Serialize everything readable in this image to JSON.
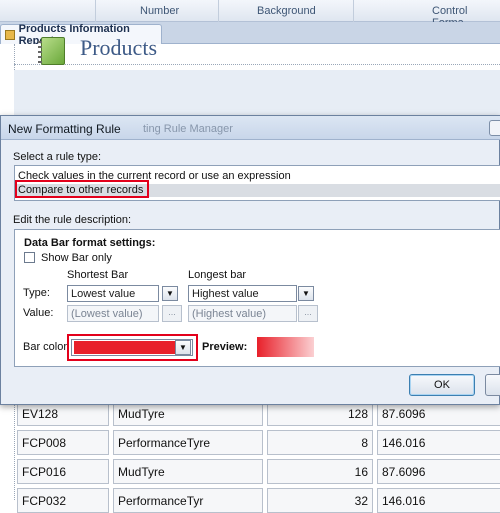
{
  "ribbon": {
    "groups": [
      "Number",
      "Background",
      "Control Forma"
    ]
  },
  "document_tab": {
    "label": "Products Information Report"
  },
  "report": {
    "title": "Products",
    "rows": [
      {
        "code": "EV128",
        "name": "MudTyre",
        "qty": "128",
        "price": "87.6096"
      },
      {
        "code": "FCP008",
        "name": "PerformanceTyre",
        "qty": "8",
        "price": "146.016"
      },
      {
        "code": "FCP016",
        "name": "MudTyre",
        "qty": "16",
        "price": "87.6096"
      },
      {
        "code": "FCP032",
        "name": "PerformanceTyr",
        "qty": "32",
        "price": "146.016"
      }
    ]
  },
  "dialog": {
    "title": "New Formatting Rule",
    "ghost_title": "ting Rule Manager",
    "select_rule_label": "Select a rule type:",
    "rule_types": [
      "Check values in the current record or use an expression",
      "Compare to other records"
    ],
    "selected_rule_index": 1,
    "edit_description_label": "Edit the rule description:",
    "databar_heading": "Data Bar format settings:",
    "show_bar_only_label": "Show Bar only",
    "show_bar_only_checked": false,
    "shortest_bar_label": "Shortest Bar",
    "longest_bar_label": "Longest bar",
    "type_label": "Type:",
    "value_label": "Value:",
    "shortest_type": "Lowest value",
    "longest_type": "Highest value",
    "shortest_value_placeholder": "(Lowest value)",
    "longest_value_placeholder": "(Highest value)",
    "ellipsis": "...",
    "bar_color_label": "Bar color",
    "bar_color_value": "#e8202a",
    "preview_label": "Preview:",
    "ok_label": "OK"
  },
  "colors": {
    "highlight": "#e3001b",
    "bar": "#e8202a",
    "title_blue": "#3d5a87"
  }
}
